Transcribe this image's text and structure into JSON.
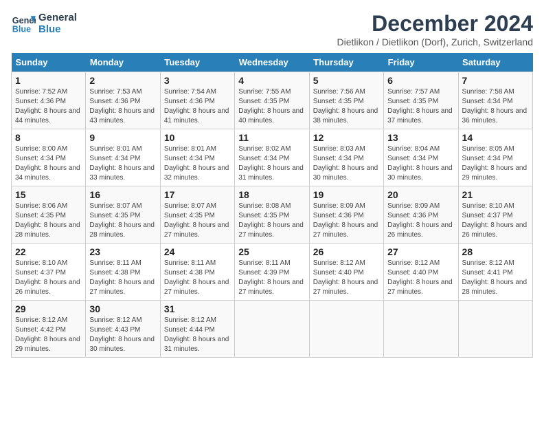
{
  "header": {
    "logo_line1": "General",
    "logo_line2": "Blue",
    "month_title": "December 2024",
    "location": "Dietlikon / Dietlikon (Dorf), Zurich, Switzerland"
  },
  "weekdays": [
    "Sunday",
    "Monday",
    "Tuesday",
    "Wednesday",
    "Thursday",
    "Friday",
    "Saturday"
  ],
  "weeks": [
    [
      {
        "day": 1,
        "sunrise": "7:52 AM",
        "sunset": "4:36 PM",
        "daylight": "8 hours and 44 minutes."
      },
      {
        "day": 2,
        "sunrise": "7:53 AM",
        "sunset": "4:36 PM",
        "daylight": "8 hours and 43 minutes."
      },
      {
        "day": 3,
        "sunrise": "7:54 AM",
        "sunset": "4:36 PM",
        "daylight": "8 hours and 41 minutes."
      },
      {
        "day": 4,
        "sunrise": "7:55 AM",
        "sunset": "4:35 PM",
        "daylight": "8 hours and 40 minutes."
      },
      {
        "day": 5,
        "sunrise": "7:56 AM",
        "sunset": "4:35 PM",
        "daylight": "8 hours and 38 minutes."
      },
      {
        "day": 6,
        "sunrise": "7:57 AM",
        "sunset": "4:35 PM",
        "daylight": "8 hours and 37 minutes."
      },
      {
        "day": 7,
        "sunrise": "7:58 AM",
        "sunset": "4:34 PM",
        "daylight": "8 hours and 36 minutes."
      }
    ],
    [
      {
        "day": 8,
        "sunrise": "8:00 AM",
        "sunset": "4:34 PM",
        "daylight": "8 hours and 34 minutes."
      },
      {
        "day": 9,
        "sunrise": "8:01 AM",
        "sunset": "4:34 PM",
        "daylight": "8 hours and 33 minutes."
      },
      {
        "day": 10,
        "sunrise": "8:01 AM",
        "sunset": "4:34 PM",
        "daylight": "8 hours and 32 minutes."
      },
      {
        "day": 11,
        "sunrise": "8:02 AM",
        "sunset": "4:34 PM",
        "daylight": "8 hours and 31 minutes."
      },
      {
        "day": 12,
        "sunrise": "8:03 AM",
        "sunset": "4:34 PM",
        "daylight": "8 hours and 30 minutes."
      },
      {
        "day": 13,
        "sunrise": "8:04 AM",
        "sunset": "4:34 PM",
        "daylight": "8 hours and 30 minutes."
      },
      {
        "day": 14,
        "sunrise": "8:05 AM",
        "sunset": "4:34 PM",
        "daylight": "8 hours and 29 minutes."
      }
    ],
    [
      {
        "day": 15,
        "sunrise": "8:06 AM",
        "sunset": "4:35 PM",
        "daylight": "8 hours and 28 minutes."
      },
      {
        "day": 16,
        "sunrise": "8:07 AM",
        "sunset": "4:35 PM",
        "daylight": "8 hours and 28 minutes."
      },
      {
        "day": 17,
        "sunrise": "8:07 AM",
        "sunset": "4:35 PM",
        "daylight": "8 hours and 27 minutes."
      },
      {
        "day": 18,
        "sunrise": "8:08 AM",
        "sunset": "4:35 PM",
        "daylight": "8 hours and 27 minutes."
      },
      {
        "day": 19,
        "sunrise": "8:09 AM",
        "sunset": "4:36 PM",
        "daylight": "8 hours and 27 minutes."
      },
      {
        "day": 20,
        "sunrise": "8:09 AM",
        "sunset": "4:36 PM",
        "daylight": "8 hours and 26 minutes."
      },
      {
        "day": 21,
        "sunrise": "8:10 AM",
        "sunset": "4:37 PM",
        "daylight": "8 hours and 26 minutes."
      }
    ],
    [
      {
        "day": 22,
        "sunrise": "8:10 AM",
        "sunset": "4:37 PM",
        "daylight": "8 hours and 26 minutes."
      },
      {
        "day": 23,
        "sunrise": "8:11 AM",
        "sunset": "4:38 PM",
        "daylight": "8 hours and 27 minutes."
      },
      {
        "day": 24,
        "sunrise": "8:11 AM",
        "sunset": "4:38 PM",
        "daylight": "8 hours and 27 minutes."
      },
      {
        "day": 25,
        "sunrise": "8:11 AM",
        "sunset": "4:39 PM",
        "daylight": "8 hours and 27 minutes."
      },
      {
        "day": 26,
        "sunrise": "8:12 AM",
        "sunset": "4:40 PM",
        "daylight": "8 hours and 27 minutes."
      },
      {
        "day": 27,
        "sunrise": "8:12 AM",
        "sunset": "4:40 PM",
        "daylight": "8 hours and 27 minutes."
      },
      {
        "day": 28,
        "sunrise": "8:12 AM",
        "sunset": "4:41 PM",
        "daylight": "8 hours and 28 minutes."
      }
    ],
    [
      {
        "day": 29,
        "sunrise": "8:12 AM",
        "sunset": "4:42 PM",
        "daylight": "8 hours and 29 minutes."
      },
      {
        "day": 30,
        "sunrise": "8:12 AM",
        "sunset": "4:43 PM",
        "daylight": "8 hours and 30 minutes."
      },
      {
        "day": 31,
        "sunrise": "8:12 AM",
        "sunset": "4:44 PM",
        "daylight": "8 hours and 31 minutes."
      },
      null,
      null,
      null,
      null
    ]
  ]
}
